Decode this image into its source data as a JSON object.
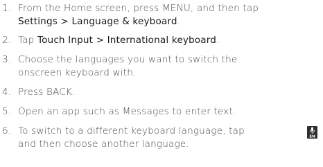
{
  "steps": [
    {
      "number": "1.",
      "line1": [
        {
          "text": "From the Home screen, press MENU, and then tap",
          "ui": false
        }
      ],
      "line2": [
        {
          "text": "Settings > Language & keyboard",
          "ui": true
        },
        {
          "text": ".",
          "ui": false
        }
      ]
    },
    {
      "number": "2.",
      "line1": [
        {
          "text": "Tap ",
          "ui": false
        },
        {
          "text": "Touch Input > International keyboard",
          "ui": true
        },
        {
          "text": ".",
          "ui": false
        }
      ]
    },
    {
      "number": "3.",
      "line1": [
        {
          "text": "Choose the languages you want to switch the",
          "ui": false
        }
      ],
      "line2": [
        {
          "text": "onscreen keyboard with.",
          "ui": false
        }
      ]
    },
    {
      "number": "4.",
      "line1": [
        {
          "text": "Press BACK.",
          "ui": false
        }
      ]
    },
    {
      "number": "5.",
      "line1": [
        {
          "text": "Open an app such as Messages to enter text.",
          "ui": false
        }
      ]
    },
    {
      "number": "6.",
      "line1": [
        {
          "text": "To switch to a different keyboard language, tap",
          "ui": false
        }
      ],
      "line2": [
        {
          "text": "and then choose another language.",
          "ui": false
        }
      ],
      "icon": {
        "name": "mic-en-key-icon",
        "label": "EN"
      }
    }
  ],
  "colors": {
    "text": "#4a4a4a",
    "ui_text": "#1a1a1a",
    "icon_bg": "#2f2f2f",
    "icon_fg": "#ffffff"
  }
}
